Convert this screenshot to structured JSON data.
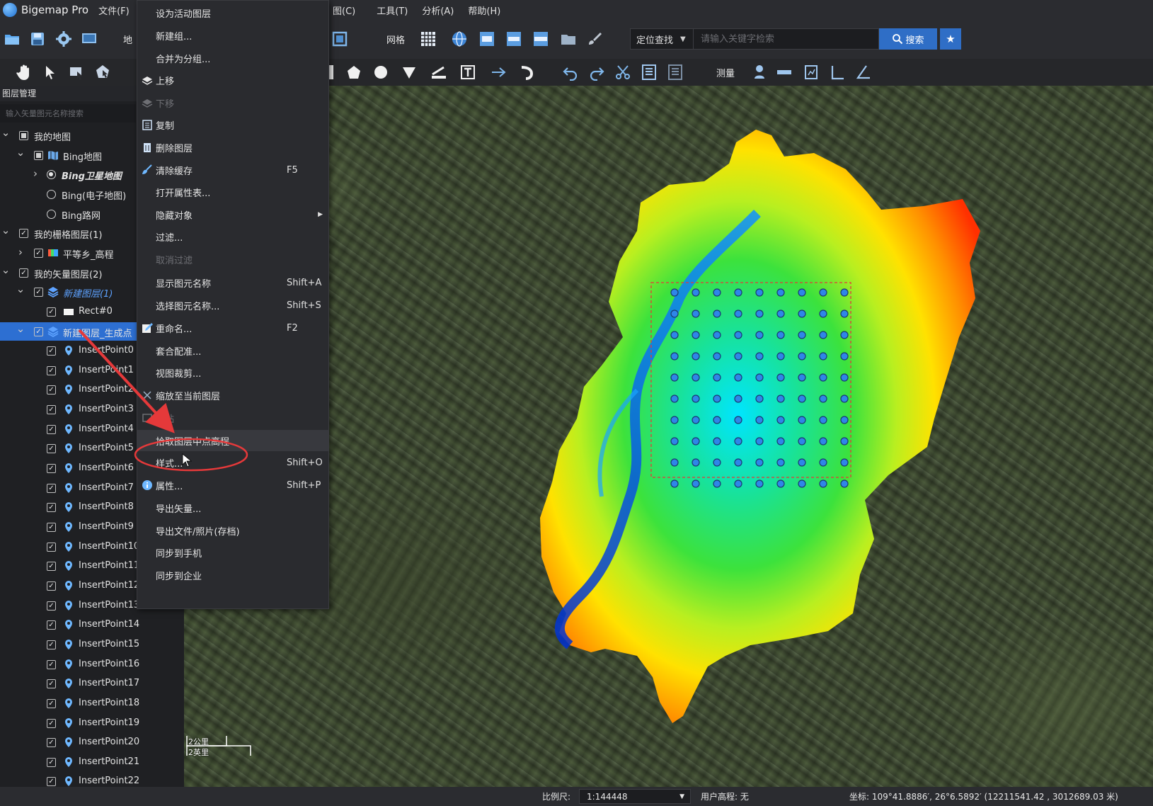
{
  "app": {
    "title": "Bigemap Pro"
  },
  "menu": {
    "left": [
      {
        "label": "文件(F)"
      }
    ],
    "right": [
      {
        "label": "图(C)"
      },
      {
        "label": "工具(T)"
      },
      {
        "label": "分析(A)"
      },
      {
        "label": "帮助(H)"
      }
    ]
  },
  "toolbar1": {
    "partial_label": "地",
    "grid_label": "网格",
    "search_type": "定位查找",
    "search_placeholder": "请输入关键字检索",
    "search_button": "搜索"
  },
  "toolbar2": {
    "measure_label": "测量"
  },
  "layer_panel": {
    "title": "图层管理",
    "search_placeholder": "输入矢量图元名称搜索",
    "tree": [
      {
        "label": "我的地图",
        "indent": 0,
        "ctl": "partial",
        "exp": "open"
      },
      {
        "label": "Bing地图",
        "indent": 1,
        "ctl": "partial",
        "exp": "open",
        "icon": "map-icon"
      },
      {
        "label": "Bing卫星地图",
        "indent": 2,
        "ctl": "radio-on",
        "exp": "closed",
        "style": "italic-bold"
      },
      {
        "label": "Bing(电子地图)",
        "indent": 2,
        "ctl": "radio"
      },
      {
        "label": "Bing路网",
        "indent": 2,
        "ctl": "radio"
      },
      {
        "label": "我的栅格图层(1)",
        "indent": 0,
        "ctl": "check",
        "exp": "open"
      },
      {
        "label": "平等乡_高程",
        "indent": 1,
        "ctl": "check",
        "exp": "closed",
        "icon": "raster-icon"
      },
      {
        "label": "我的矢量图层(2)",
        "indent": 0,
        "ctl": "check",
        "exp": "open"
      },
      {
        "label": "新建图层(1)",
        "indent": 1,
        "ctl": "check",
        "exp": "open",
        "icon": "layers-icon",
        "style": "italic-blue"
      },
      {
        "label": "Rect#0",
        "indent": 2,
        "ctl": "check",
        "icon": "rect-icon"
      },
      {
        "label": "新建图层_生成点",
        "indent": 1,
        "ctl": "check",
        "exp": "open",
        "icon": "layers-icon",
        "selected": true
      },
      {
        "label": "InsertPoint0",
        "indent": 2,
        "ctl": "check",
        "icon": "pin-icon"
      },
      {
        "label": "InsertPoint1",
        "indent": 2,
        "ctl": "check",
        "icon": "pin-icon"
      },
      {
        "label": "InsertPoint2",
        "indent": 2,
        "ctl": "check",
        "icon": "pin-icon"
      },
      {
        "label": "InsertPoint3",
        "indent": 2,
        "ctl": "check",
        "icon": "pin-icon"
      },
      {
        "label": "InsertPoint4",
        "indent": 2,
        "ctl": "check",
        "icon": "pin-icon"
      },
      {
        "label": "InsertPoint5",
        "indent": 2,
        "ctl": "check",
        "icon": "pin-icon"
      },
      {
        "label": "InsertPoint6",
        "indent": 2,
        "ctl": "check",
        "icon": "pin-icon"
      },
      {
        "label": "InsertPoint7",
        "indent": 2,
        "ctl": "check",
        "icon": "pin-icon"
      },
      {
        "label": "InsertPoint8",
        "indent": 2,
        "ctl": "check",
        "icon": "pin-icon"
      },
      {
        "label": "InsertPoint9",
        "indent": 2,
        "ctl": "check",
        "icon": "pin-icon"
      },
      {
        "label": "InsertPoint10",
        "indent": 2,
        "ctl": "check",
        "icon": "pin-icon"
      },
      {
        "label": "InsertPoint11",
        "indent": 2,
        "ctl": "check",
        "icon": "pin-icon"
      },
      {
        "label": "InsertPoint12",
        "indent": 2,
        "ctl": "check",
        "icon": "pin-icon"
      },
      {
        "label": "InsertPoint13",
        "indent": 2,
        "ctl": "check",
        "icon": "pin-icon"
      },
      {
        "label": "InsertPoint14",
        "indent": 2,
        "ctl": "check",
        "icon": "pin-icon"
      },
      {
        "label": "InsertPoint15",
        "indent": 2,
        "ctl": "check",
        "icon": "pin-icon"
      },
      {
        "label": "InsertPoint16",
        "indent": 2,
        "ctl": "check",
        "icon": "pin-icon"
      },
      {
        "label": "InsertPoint17",
        "indent": 2,
        "ctl": "check",
        "icon": "pin-icon"
      },
      {
        "label": "InsertPoint18",
        "indent": 2,
        "ctl": "check",
        "icon": "pin-icon"
      },
      {
        "label": "InsertPoint19",
        "indent": 2,
        "ctl": "check",
        "icon": "pin-icon"
      },
      {
        "label": "InsertPoint20",
        "indent": 2,
        "ctl": "check",
        "icon": "pin-icon"
      },
      {
        "label": "InsertPoint21",
        "indent": 2,
        "ctl": "check",
        "icon": "pin-icon"
      },
      {
        "label": "InsertPoint22",
        "indent": 2,
        "ctl": "check",
        "icon": "pin-icon"
      }
    ]
  },
  "context_menu": [
    {
      "label": "设为活动图层"
    },
    {
      "label": "新建组..."
    },
    {
      "label": "合并为分组..."
    },
    {
      "label": "上移",
      "icon": "move-up-icon"
    },
    {
      "label": "下移",
      "icon": "move-down-icon",
      "disabled": true
    },
    {
      "label": "复制",
      "icon": "copy-icon"
    },
    {
      "label": "删除图层",
      "icon": "delete-icon"
    },
    {
      "label": "清除缓存",
      "icon": "broom-icon",
      "shortcut": "F5"
    },
    {
      "label": "打开属性表..."
    },
    {
      "label": "隐藏对象",
      "submenu": true
    },
    {
      "label": "过滤..."
    },
    {
      "label": "取消过滤",
      "disabled": true
    },
    {
      "label": "显示图元名称",
      "shortcut": "Shift+A"
    },
    {
      "label": "选择图元名称...",
      "shortcut": "Shift+S"
    },
    {
      "label": "重命名...",
      "icon": "rename-icon",
      "shortcut": "F2"
    },
    {
      "label": "套合配准..."
    },
    {
      "label": "视图裁剪..."
    },
    {
      "label": "缩放至当前图层",
      "icon": "zoom-icon"
    },
    {
      "label": "粘贴",
      "icon": "paste-icon",
      "disabled": true
    },
    {
      "label": "拾取图层中点高程",
      "highlighted": true
    },
    {
      "label": "样式...",
      "shortcut": "Shift+O"
    },
    {
      "label": "属性...",
      "icon": "info-icon",
      "shortcut": "Shift+P"
    },
    {
      "label": "导出矢量..."
    },
    {
      "label": "导出文件/照片(存档)"
    },
    {
      "label": "同步到手机"
    },
    {
      "label": "同步到企业"
    }
  ],
  "map": {
    "scale_km": "2公里",
    "scale_mi": "2英里",
    "grid": {
      "rows": 10,
      "cols": 10
    }
  },
  "status": {
    "scale_label": "比例尺:",
    "scale_value": "1:144448",
    "elevation_label": "用户高程: 无",
    "coord_text": "坐标: 109°41.8886′, 26°6.5892′  (12211541.42 , 3012689.03 米)"
  },
  "colors": {
    "accent": "#2f6ec6",
    "annotation_red": "#e5393a",
    "selection_blue": "#2d6fd2"
  }
}
